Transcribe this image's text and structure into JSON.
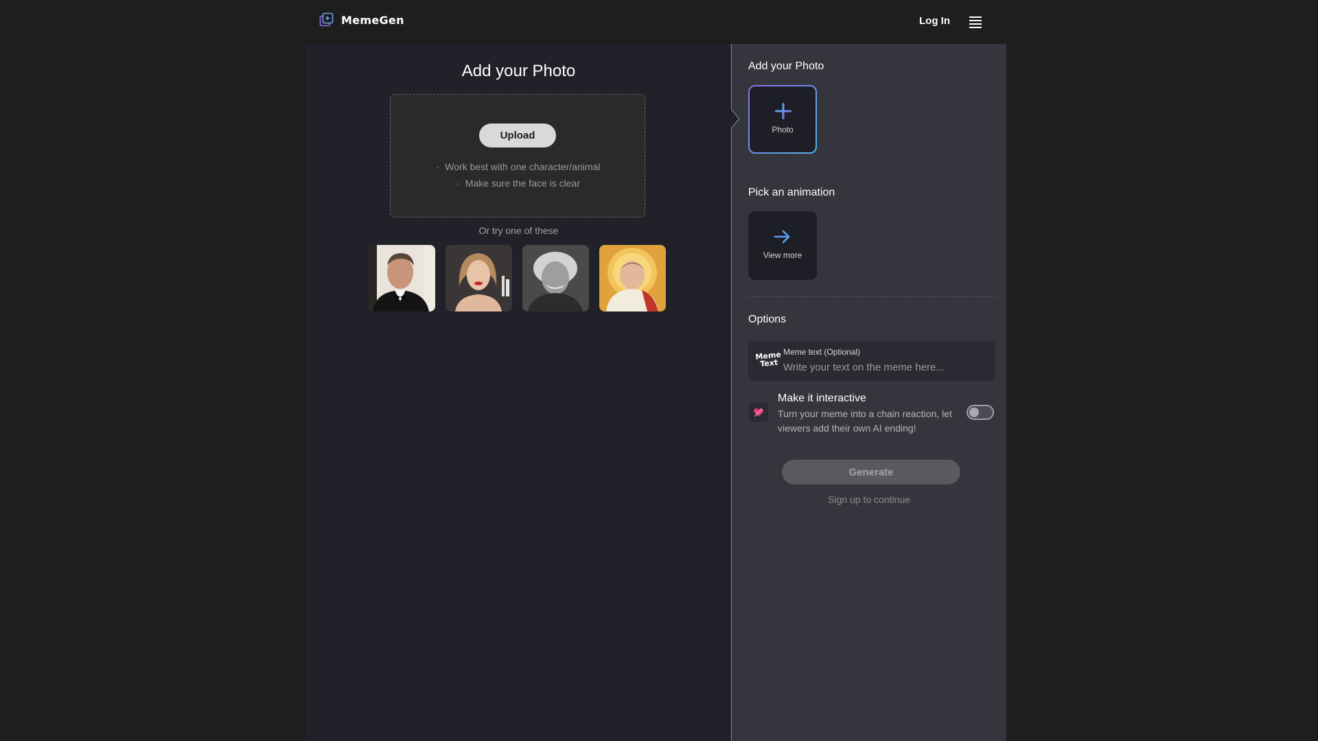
{
  "header": {
    "brand_name": "MemeGen",
    "login_label": "Log In",
    "logo_icon": "photo-stack-play-icon",
    "menu_icon": "hamburger-menu-icon"
  },
  "left": {
    "title": "Add your Photo",
    "upload_label": "Upload",
    "tips": [
      "Work best with one character/animal",
      "Make sure the face is clear"
    ],
    "tip_bullet": "·",
    "try_label": "Or try one of these",
    "samples": [
      {
        "name": "sample-photo-man-tuxedo"
      },
      {
        "name": "sample-photo-woman-red-lips"
      },
      {
        "name": "sample-photo-elderly-man-bw"
      },
      {
        "name": "sample-photo-halo-portrait"
      }
    ]
  },
  "right": {
    "photo_section_title": "Add your Photo",
    "photo_card_label": "Photo",
    "animation_section_title": "Pick an animation",
    "view_more_label": "View more",
    "options_title": "Options",
    "meme_badge_line1": "Meme",
    "meme_badge_line2": "Text",
    "meme_text_label": "Meme text (Optional)",
    "meme_text_placeholder": "Write your text on the meme here...",
    "meme_text_value": "",
    "interactive_title": "Make it interactive",
    "interactive_desc": "Turn your meme into a chain reaction, let viewers add their own AI ending!",
    "interactive_enabled": false,
    "generate_label": "Generate",
    "signup_note": "Sign up to continue"
  },
  "colors": {
    "page_bg": "#1e1e1e",
    "left_panel_bg": "#21212a",
    "right_panel_bg": "#35353d",
    "accent_blue": "#4fb6e8",
    "accent_purple": "#8a6cf0",
    "heart_pink": "#e8457a"
  }
}
